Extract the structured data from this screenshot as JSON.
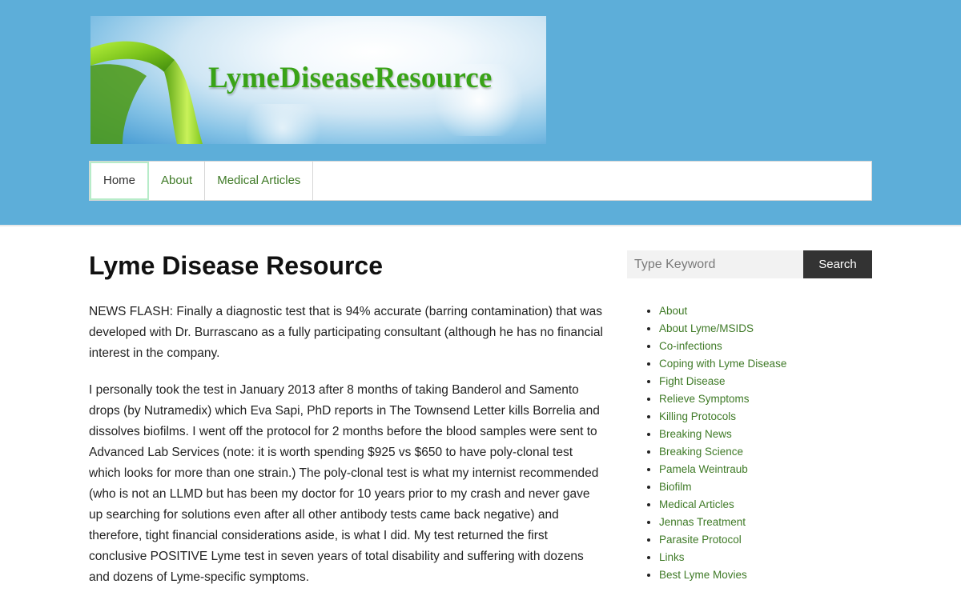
{
  "header": {
    "logo_text": "LymeDiseaseResource",
    "banner_icon": "green-ribbon"
  },
  "nav": {
    "items": [
      {
        "label": "Home",
        "active": true
      },
      {
        "label": "About",
        "active": false
      },
      {
        "label": "Medical Articles",
        "active": false
      }
    ]
  },
  "main": {
    "title": "Lyme Disease Resource",
    "paragraphs": [
      "NEWS FLASH: Finally a diagnostic test that is 94% accurate (barring contamination) that was developed with Dr. Burrascano as a fully participating consultant (although he has no financial interest in the company.",
      "I personally took the test in January 2013 after 8 months of taking Banderol and Samento drops (by Nutramedix) which Eva Sapi, PhD reports in The Townsend Letter kills Borrelia and dissolves biofilms.  I went off the protocol for 2 months before the blood samples were sent to Advanced Lab Services (note: it is worth spending $925 vs $650 to have poly-clonal test which looks for more than one strain.)  The poly-clonal test is what my internist recommended (who is not an LLMD but has been my doctor for 10 years prior to my crash and never gave up searching for solutions even after all other antibody tests came back negative) and therefore, tight financial considerations aside, is what I did.  My test returned the first conclusive POSITIVE Lyme test in seven years of total disability and suffering with dozens and dozens of Lyme-specific symptoms."
    ]
  },
  "sidebar": {
    "search": {
      "placeholder": "Type Keyword",
      "button_label": "Search"
    },
    "links": [
      "About",
      "About Lyme/MSIDS",
      "Co-infections",
      "Coping with Lyme Disease",
      "Fight Disease",
      "Relieve Symptoms",
      "Killing Protocols",
      "Breaking News",
      "Breaking Science",
      "Pamela Weintraub",
      "Biofilm",
      "Medical Articles",
      "Jennas Treatment",
      "Parasite Protocol",
      "Links",
      "Best Lyme Movies"
    ]
  },
  "colors": {
    "header_bg": "#5daed9",
    "link_green": "#3f7a27",
    "logo_green": "#39a317",
    "button_dark": "#333333"
  }
}
